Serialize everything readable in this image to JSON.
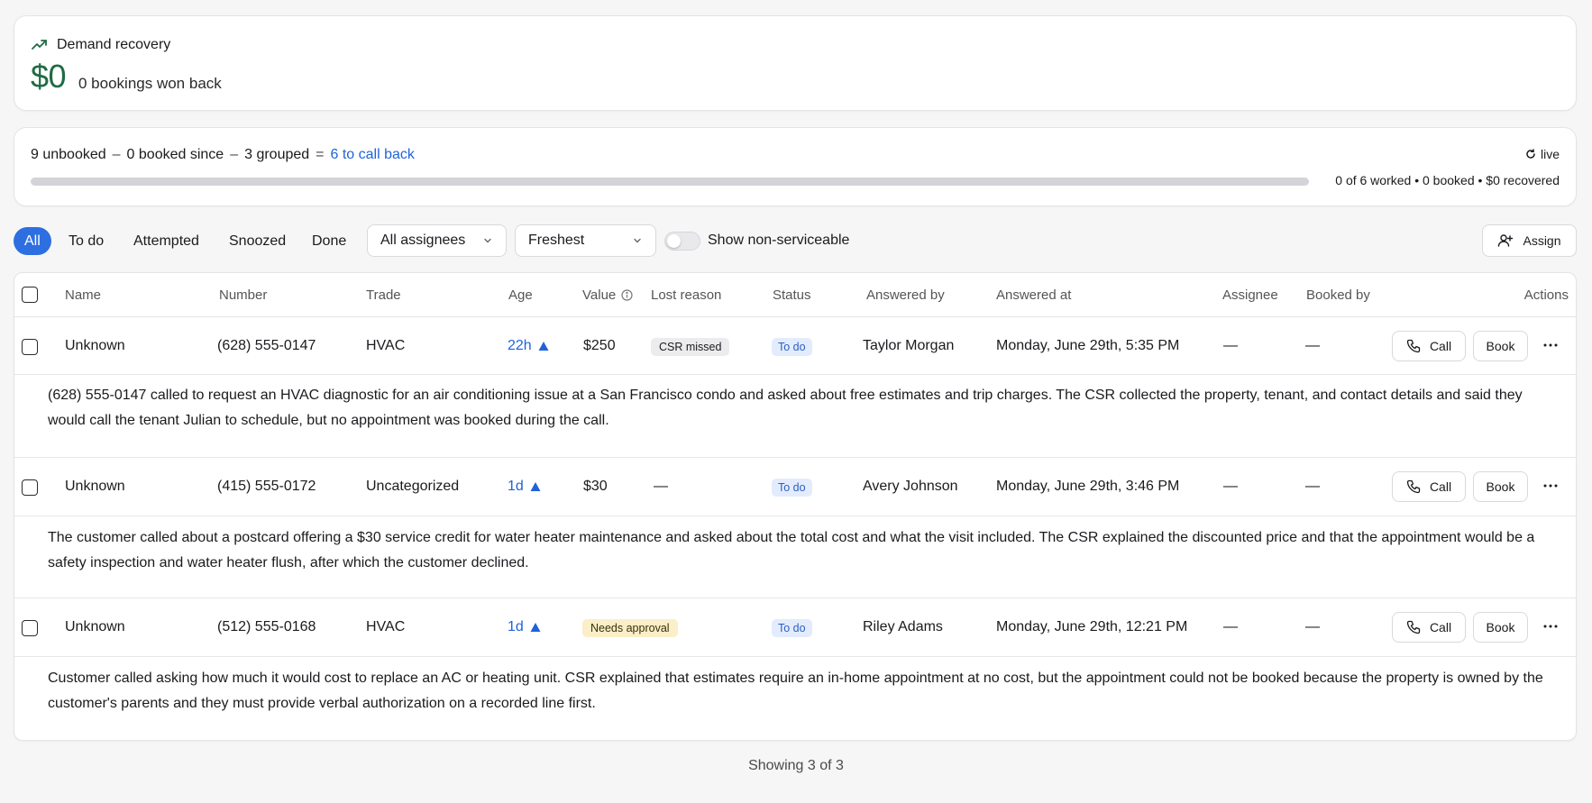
{
  "demand": {
    "title": "Demand recovery",
    "amount": "$0",
    "subtitle": "0 bookings won back",
    "colors": {
      "accent": "#1f6b45"
    }
  },
  "summary": {
    "unbooked": "9 unbooked",
    "minus1": "–",
    "booked_since": "0 booked since",
    "minus2": "–",
    "grouped": "3 grouped",
    "equals": "=",
    "call_back": "6 to call back",
    "live": "live",
    "stats": "0 of 6 worked • 0 booked • $0 recovered",
    "progress_fraction": 0
  },
  "toolbar": {
    "tabs": [
      "All",
      "To do",
      "Attempted",
      "Snoozed",
      "Done"
    ],
    "active_tab": "All",
    "assignee_select": "All assignees",
    "sort_select": "Freshest",
    "toggle_label": "Show non-serviceable",
    "toggle_on": false,
    "assign_label": "Assign"
  },
  "table": {
    "columns": {
      "name": "Name",
      "number": "Number",
      "trade": "Trade",
      "age": "Age",
      "value": "Value",
      "lost_reason": "Lost reason",
      "status": "Status",
      "answered_by": "Answered by",
      "answered_at": "Answered at",
      "assignee": "Assignee",
      "booked_by": "Booked by",
      "actions": "Actions"
    },
    "rows": [
      {
        "name": "Unknown",
        "number": "(628) 555-0147",
        "trade": "HVAC",
        "age": "22h",
        "value": "$250",
        "lost_reason": "CSR missed",
        "status": "To do",
        "answered_by": "Taylor Morgan",
        "answered_at": "Monday, June 29th, 5:35 PM",
        "assignee": "—",
        "booked_by": "—",
        "call": "Call",
        "book": "Book",
        "summary": "(628) 555-0147 called to request an HVAC diagnostic for an air conditioning issue at a San Francisco condo and asked about free estimates and trip charges. The CSR collected the property, tenant, and contact details and said they would call the tenant Julian to schedule, but no appointment was booked during the call."
      },
      {
        "name": "Unknown",
        "number": "(415) 555-0172",
        "trade": "Uncategorized",
        "age": "1d",
        "value": "$30",
        "lost_reason": "—",
        "status": "To do",
        "answered_by": "Avery Johnson",
        "answered_at": "Monday, June 29th, 3:46 PM",
        "assignee": "—",
        "booked_by": "—",
        "call": "Call",
        "book": "Book",
        "summary": "The customer called about a postcard offering a $30 service credit for water heater maintenance and asked about the total cost and what the visit included. The CSR explained the discounted price and that the appointment would be a safety inspection and water heater flush, after which the customer declined."
      },
      {
        "name": "Unknown",
        "number": "(512) 555-0168",
        "trade": "HVAC",
        "age": "1d",
        "value": "",
        "lost_reason": "Needs approval",
        "status": "To do",
        "answered_by": "Riley Adams",
        "answered_at": "Monday, June 29th, 12:21 PM",
        "assignee": "—",
        "booked_by": "—",
        "call": "Call",
        "book": "Book",
        "summary": "Customer called asking how much it would cost to replace an AC or heating unit. CSR explained that estimates require an in-home appointment at no cost, but the appointment could not be booked because the property is owned by the customer's parents and they must provide verbal authorization on a recorded line first."
      }
    ],
    "footer": "Showing 3 of 3"
  }
}
